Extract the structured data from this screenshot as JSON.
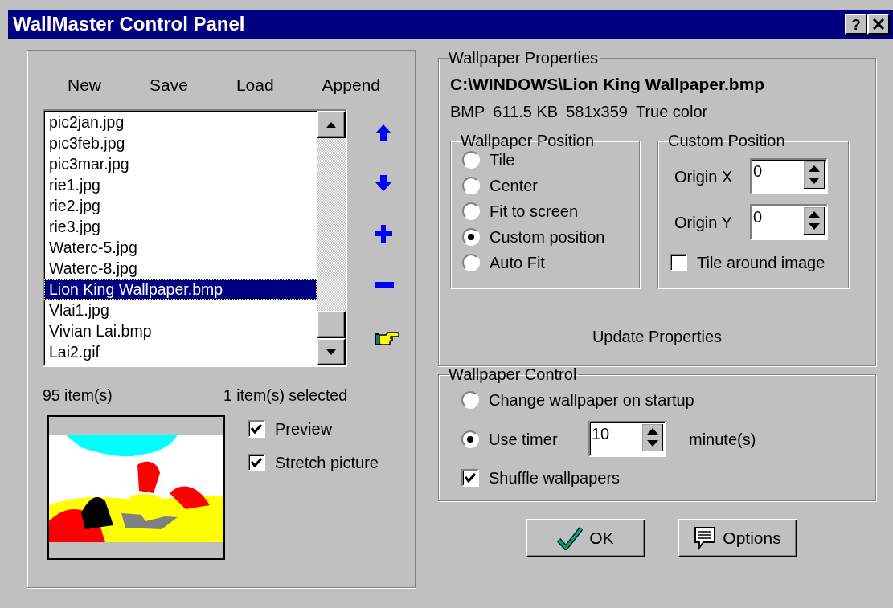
{
  "window": {
    "title": "WallMaster Control Panel",
    "help_label": "?"
  },
  "playlist": {
    "actions": [
      "New",
      "Save",
      "Load",
      "Append"
    ],
    "files": [
      {
        "name": "pic2jan.jpg",
        "selected": false
      },
      {
        "name": "pic3feb.jpg",
        "selected": false
      },
      {
        "name": "pic3mar.jpg",
        "selected": false
      },
      {
        "name": "rie1.jpg",
        "selected": false
      },
      {
        "name": "rie2.jpg",
        "selected": false
      },
      {
        "name": "rie3.jpg",
        "selected": false
      },
      {
        "name": "Waterc-5.jpg",
        "selected": false
      },
      {
        "name": "Waterc-8.jpg",
        "selected": false
      },
      {
        "name": "Lion King Wallpaper.bmp",
        "selected": true
      },
      {
        "name": "Vlai1.jpg",
        "selected": false
      },
      {
        "name": "Vivian Lai.bmp",
        "selected": false
      },
      {
        "name": "Lai2.gif",
        "selected": false
      }
    ],
    "item_count": "95 item(s)",
    "selection_count": "1 item(s) selected"
  },
  "preview": {
    "options": [
      {
        "label": "Preview",
        "checked": true
      },
      {
        "label": "Stretch picture",
        "checked": true
      }
    ]
  },
  "properties": {
    "title": "Wallpaper Properties",
    "path": "C:\\WINDOWS\\Lion King Wallpaper.bmp",
    "info": [
      "BMP",
      "611.5 KB",
      "581x359",
      "True color"
    ],
    "position": {
      "title": "Wallpaper Position",
      "options": [
        {
          "label": "Tile",
          "selected": false
        },
        {
          "label": "Center",
          "selected": false
        },
        {
          "label": "Fit to screen",
          "selected": false
        },
        {
          "label": "Custom position",
          "selected": true
        },
        {
          "label": "Auto Fit",
          "selected": false
        }
      ]
    },
    "custom": {
      "title": "Custom Position",
      "fields": [
        {
          "label": "Origin X",
          "value": "0"
        },
        {
          "label": "Origin Y",
          "value": "0"
        }
      ],
      "tile_around": {
        "label": "Tile around image",
        "checked": false
      }
    },
    "update_button": "Update Properties"
  },
  "control": {
    "title": "Wallpaper Control",
    "modes": [
      {
        "kind": "plain",
        "label": "Change wallpaper on startup",
        "selected": false
      },
      {
        "kind": "timer",
        "label": "Use timer",
        "selected": true,
        "value": "10",
        "unit": "minute(s)"
      }
    ],
    "shuffle": {
      "label": "Shuffle wallpapers",
      "checked": true
    }
  },
  "buttons": [
    {
      "kind": "ok",
      "label": "OK"
    },
    {
      "kind": "options",
      "label": "Options"
    }
  ]
}
